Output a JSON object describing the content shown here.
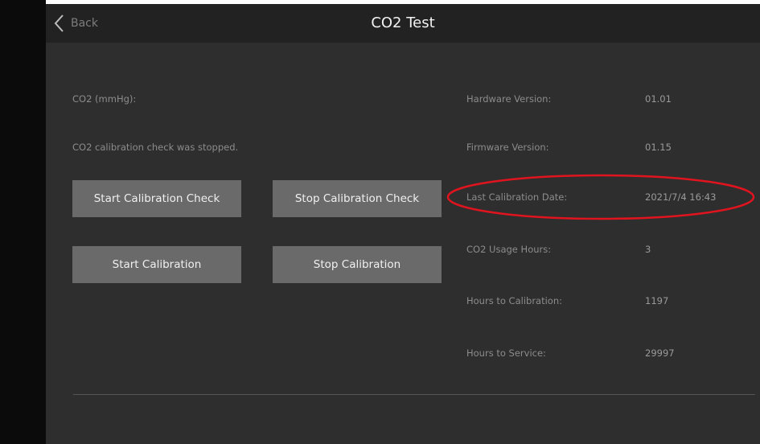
{
  "header": {
    "back_label": "Back",
    "title": "CO2 Test"
  },
  "main": {
    "co2_label": "CO2 (mmHg):",
    "status_message": "CO2 calibration check was stopped.",
    "buttons": {
      "start_calibration_check": "Start Calibration Check",
      "stop_calibration_check": "Stop Calibration Check",
      "start_calibration": "Start Calibration",
      "stop_calibration": "Stop Calibration"
    }
  },
  "info": [
    {
      "label": "Hardware Version:",
      "value": "01.01"
    },
    {
      "label": "Firmware Version:",
      "value": "01.15"
    },
    {
      "label": "Last Calibration Date:",
      "value": "2021/7/4 16:43"
    },
    {
      "label": "CO2 Usage Hours:",
      "value": "3"
    },
    {
      "label": "Hours to Calibration:",
      "value": "1197"
    },
    {
      "label": "Hours to Service:",
      "value": "29997"
    }
  ],
  "colors": {
    "background": "#2e2e2e",
    "header": "#222222",
    "button": "#6a6a6a",
    "highlight": "#e0141e"
  },
  "icons": {
    "back": "chevron-left-icon"
  }
}
